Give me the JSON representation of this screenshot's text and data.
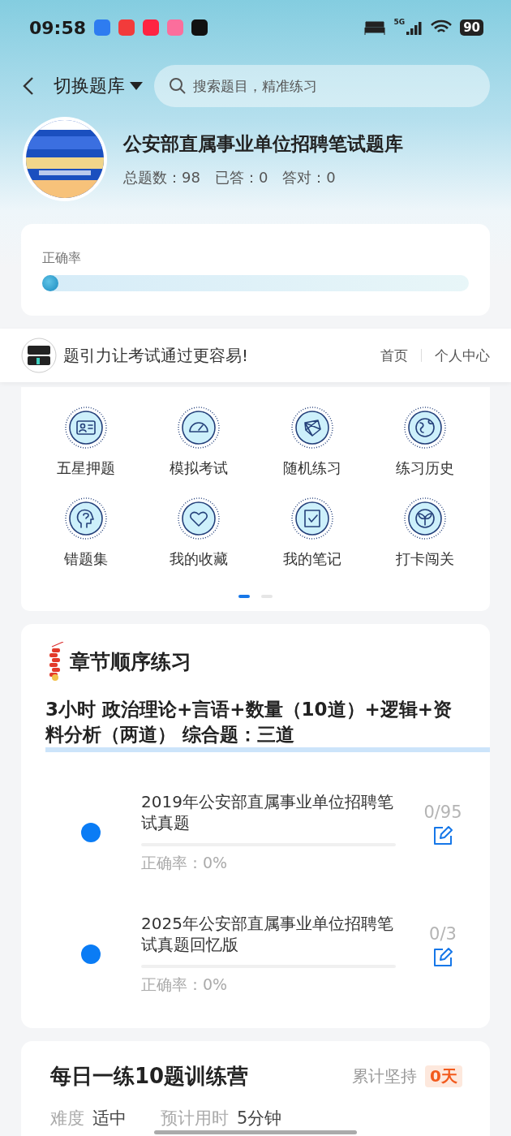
{
  "status_bar": {
    "time": "09:58",
    "network": "5G",
    "battery": "90"
  },
  "header": {
    "switch_label": "切换题库",
    "search": {
      "placeholder": "搜索题目，精准练习"
    }
  },
  "bank": {
    "title": "公安部直属事业单位招聘笔试题库",
    "stats": [
      {
        "label": "总题数：",
        "value": "98"
      },
      {
        "label": "已答：",
        "value": "0"
      },
      {
        "label": "答对：",
        "value": "0"
      }
    ]
  },
  "accuracy": {
    "label": "正确率",
    "level": 0.02
  },
  "banner": {
    "slogan": "题引力让考试通过更容易!",
    "links": [
      "首页",
      "个人中心"
    ]
  },
  "features": {
    "items": [
      {
        "label": "五星押题",
        "kind": "card"
      },
      {
        "label": "模拟考试",
        "kind": "gauge"
      },
      {
        "label": "随机练习",
        "kind": "network"
      },
      {
        "label": "练习历史",
        "kind": "globe"
      },
      {
        "label": "错题集",
        "kind": "head"
      },
      {
        "label": "我的收藏",
        "kind": "heart"
      },
      {
        "label": "我的笔记",
        "kind": "note"
      },
      {
        "label": "打卡闯关",
        "kind": "sprout"
      }
    ],
    "pages": [
      {
        "selected": true
      },
      {
        "selected": false
      }
    ]
  },
  "chapter": {
    "title": "章节顺序练习",
    "subtitle": "3小时 政治理论+言语+数量（10道）+逻辑+资料分析（两道） 综合题：三道",
    "items": [
      {
        "title": "2019年公安部直属事业单位招聘笔试真题",
        "count": "0/95",
        "accuracy": "正确率：0%"
      },
      {
        "title": "2025年公安部直属事业单位招聘笔试真题回忆版",
        "count": "0/3",
        "accuracy": "正确率：0%"
      }
    ]
  },
  "daily": {
    "title": "每日一练10题训练营",
    "streak_label": "累计坚持",
    "streak": "0天",
    "difficulty_label": "难度",
    "difficulty": "适中",
    "time_label": "预计用时",
    "time": "5分钟"
  }
}
